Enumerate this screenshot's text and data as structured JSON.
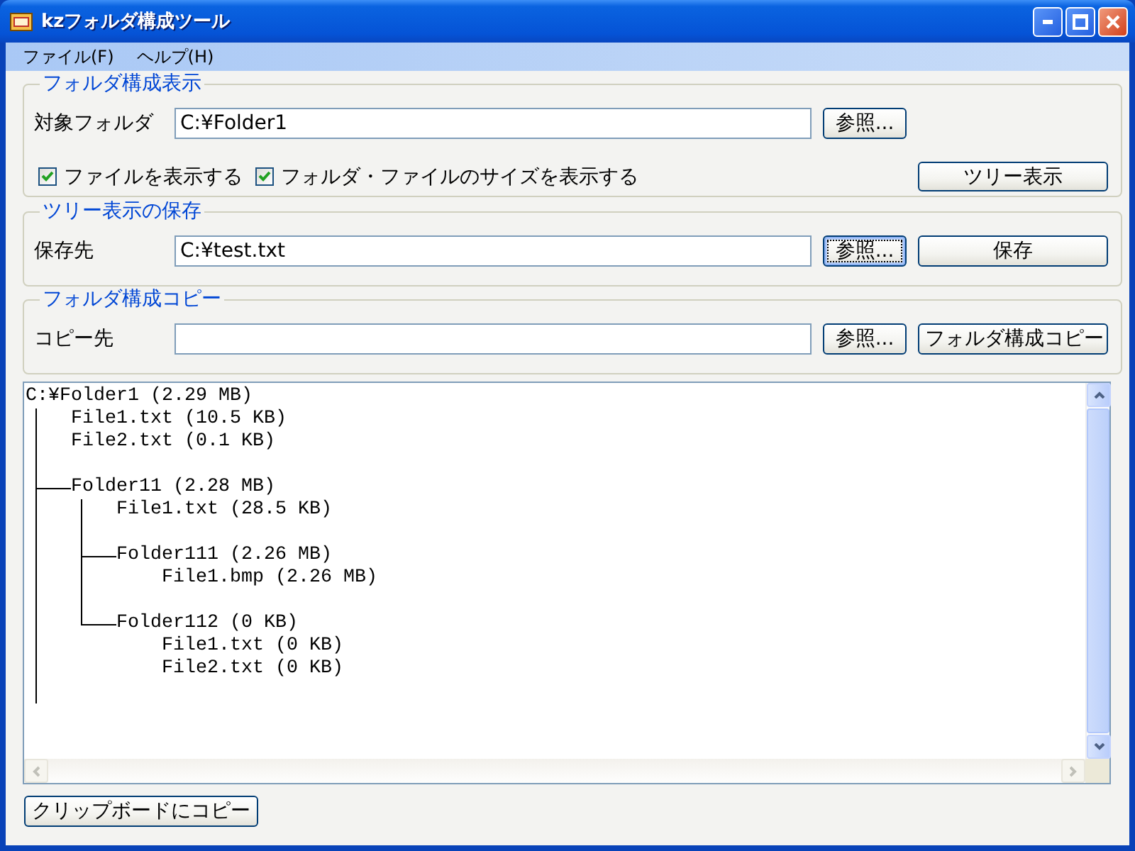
{
  "window": {
    "title": "kzフォルダ構成ツール"
  },
  "menu": [
    {
      "label": "ファイル(F)"
    },
    {
      "label": "ヘルプ(H)"
    }
  ],
  "display_group": {
    "legend": "フォルダ構成表示",
    "target_label": "対象フォルダ",
    "target_value": "C:¥Folder1",
    "browse_button": {
      "label": "参照...",
      "focused": false
    },
    "checkboxes": [
      {
        "label": "ファイルを表示する",
        "checked": true
      },
      {
        "label": "フォルダ・ファイルのサイズを表示する",
        "checked": true
      }
    ],
    "tree_button": {
      "label": "ツリー表示",
      "focused": false
    }
  },
  "save_group": {
    "legend": "ツリー表示の保存",
    "dest_label": "保存先",
    "dest_value": "C:¥test.txt",
    "browse_button": {
      "label": "参照...",
      "focused": true
    },
    "save_button": {
      "label": "保存",
      "focused": false
    }
  },
  "copy_group": {
    "legend": "フォルダ構成コピー",
    "dest_label": "コピー先",
    "browse_button": {
      "label": "参照...",
      "focused": false
    },
    "copy_button": {
      "label": "フォルダ構成コピー",
      "focused": false
    }
  },
  "tree": {
    "label": "C:¥Folder1 (2.29 MB)",
    "children": [
      {
        "kind": "file",
        "label": "File1.txt (10.5 KB)"
      },
      {
        "kind": "file",
        "label": "File2.txt (0.1 KB)"
      },
      {
        "kind": "folder",
        "label": "Folder11 (2.28 MB)",
        "children": [
          {
            "kind": "file",
            "label": "File1.txt (28.5 KB)"
          },
          {
            "kind": "folder",
            "label": "Folder111 (2.26 MB)",
            "children": [
              {
                "kind": "file",
                "label": "File1.bmp (2.26 MB)"
              }
            ]
          },
          {
            "kind": "folder",
            "label": "Folder112 (0 KB)",
            "children": [
              {
                "kind": "file",
                "label": "File1.txt (0 KB)"
              },
              {
                "kind": "file",
                "label": "File2.txt (0 KB)"
              }
            ]
          }
        ]
      }
    ]
  },
  "clipboard_button": {
    "label": "クリップボードにコピー",
    "focused": false
  }
}
